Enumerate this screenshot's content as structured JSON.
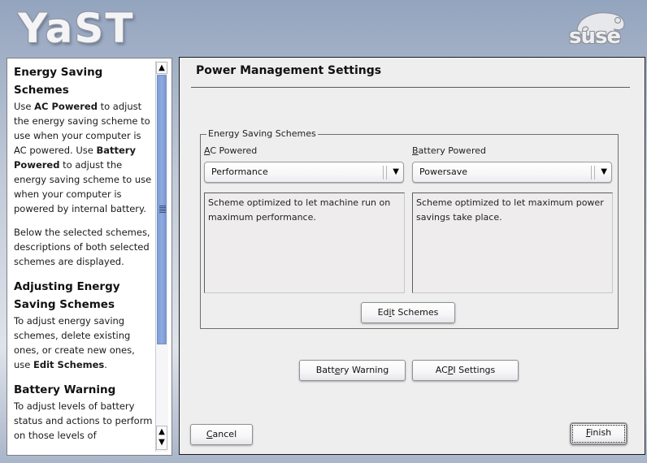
{
  "header": {
    "app_logo": "YaST",
    "vendor_logo": "suse"
  },
  "help": {
    "sections": [
      {
        "heading": "Energy Saving Schemes",
        "paragraphs": [
          [
            "Use ",
            {
              "b": "AC Powered"
            },
            " to adjust the energy saving scheme to use when your computer is AC powered. Use ",
            {
              "b": "Battery Powered"
            },
            " to adjust the energy saving scheme to use when your computer is powered by internal battery."
          ],
          [
            "Below the selected schemes, descriptions of both selected schemes are displayed."
          ]
        ]
      },
      {
        "heading": "Adjusting Energy Saving Schemes",
        "paragraphs": [
          [
            "To adjust energy saving schemes, delete existing ones, or create new ones, use ",
            {
              "b": "Edit Schemes"
            },
            "."
          ]
        ]
      },
      {
        "heading": "Battery Warning",
        "paragraphs": [
          [
            "To adjust levels of battery status and actions to perform on those levels of"
          ]
        ]
      }
    ],
    "scrollbar": {
      "position_fraction": 0.0,
      "visible_fraction": 0.7
    }
  },
  "main": {
    "title": "Power Management Settings",
    "frame_label": "Energy Saving Schemes",
    "ac": {
      "label_mnemonic": "A",
      "label_rest": "C Powered",
      "selected": "Performance",
      "description": "Scheme optimized to let machine run on maximum performance."
    },
    "battery": {
      "label_mnemonic": "B",
      "label_rest": "attery Powered",
      "selected": "Powersave",
      "description": "Scheme optimized to let maximum power savings take place."
    },
    "edit_schemes": {
      "pre": "Ed",
      "mnemonic": "i",
      "post": "t Schemes"
    },
    "battery_warning": {
      "pre": "Batt",
      "mnemonic": "e",
      "post": "ry Warning"
    },
    "acpi_settings": {
      "pre": "AC",
      "mnemonic": "P",
      "post": "I Settings"
    }
  },
  "footer": {
    "cancel": {
      "pre": "",
      "mnemonic": "C",
      "post": "ancel"
    },
    "finish": {
      "pre": "",
      "mnemonic": "F",
      "post": "inish"
    }
  },
  "icons": {
    "scroll_up": "▲",
    "scroll_down": "▼",
    "combo_arrow": "▼"
  }
}
